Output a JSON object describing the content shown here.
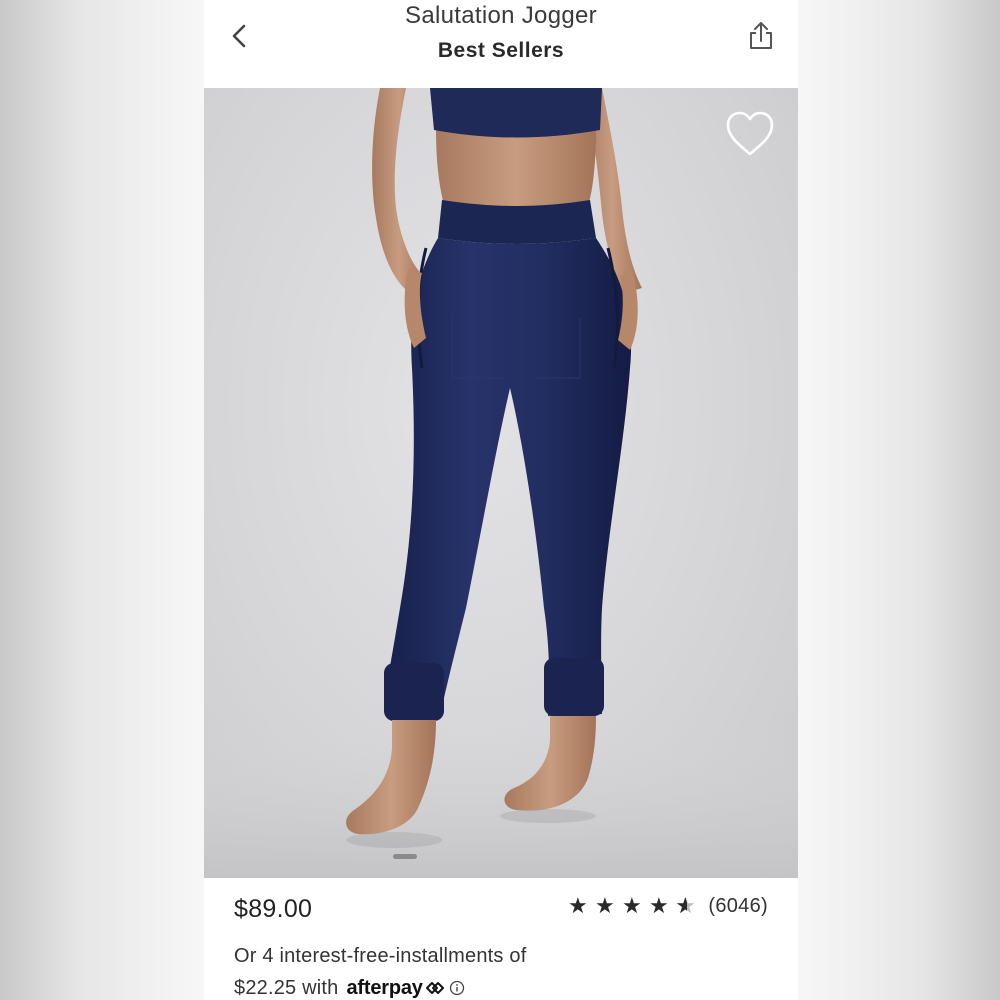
{
  "header": {
    "title": "Salutation Jogger",
    "subtitle": "Best Sellers",
    "back_icon": "chevron-left-icon",
    "share_icon": "share-icon"
  },
  "hero": {
    "favorite_icon": "heart-outline-icon",
    "image_description_colors": {
      "pants": "#1f2a52",
      "background": "#d6d6d8",
      "skin": "#c89a7e"
    },
    "pager_active_index": 1
  },
  "product": {
    "price": "$89.00",
    "rating": 4.5,
    "review_count": "(6046)",
    "installments_line1": "Or 4 interest-free-installments of",
    "installments_amount": "$22.25 with",
    "afterpay_brand": "afterpay"
  }
}
